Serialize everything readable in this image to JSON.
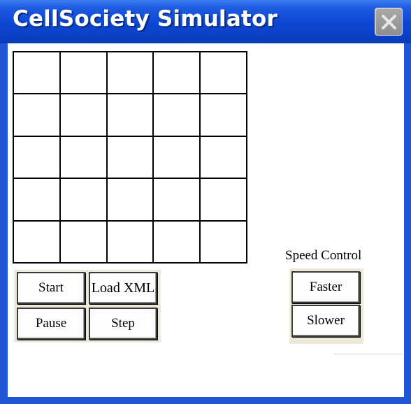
{
  "window": {
    "title": "CellSociety Simulator",
    "close_icon": "close-x-icon",
    "colors": {
      "titlebar": "#0b46d2",
      "frame": "#1f57d6",
      "close_button": "#9a9a9a",
      "panel": "#ece9d8",
      "client": "#ffffff"
    }
  },
  "grid": {
    "rows": 5,
    "columns": 5
  },
  "controls": {
    "start_label": "Start",
    "load_xml_label": "Load XML",
    "pause_label": "Pause",
    "step_label": "Step"
  },
  "speed_control": {
    "label": "Speed Control",
    "faster_label": "Faster",
    "slower_label": "Slower"
  }
}
